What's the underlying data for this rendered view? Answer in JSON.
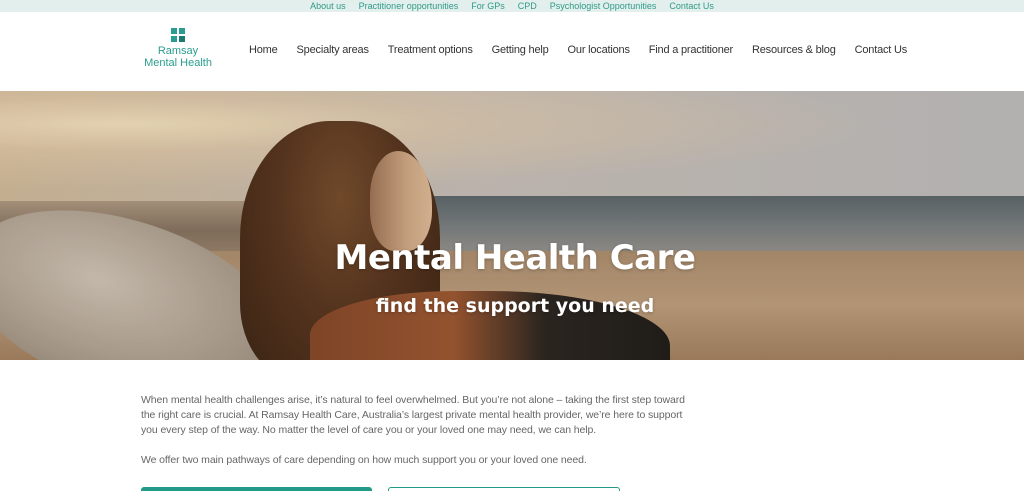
{
  "utility_nav": {
    "items": [
      "About us",
      "Practitioner opportunities",
      "For GPs",
      "CPD",
      "Psychologist Opportunities",
      "Contact Us"
    ]
  },
  "logo": {
    "line1": "Ramsay",
    "line2": "Mental Health",
    "icon": "ramsay-cross-logo"
  },
  "main_nav": {
    "items": [
      "Home",
      "Specialty areas",
      "Treatment options",
      "Getting help",
      "Our locations",
      "Find a practitioner",
      "Resources & blog",
      "Contact Us"
    ]
  },
  "hero": {
    "title": "Mental Health Care",
    "subtitle": "find the support you need"
  },
  "intro": {
    "paragraph1": "When mental health challenges arise, it’s natural to feel overwhelmed. But you’re not alone – taking the first step toward the right care is crucial. At Ramsay Health Care, Australia’s largest private mental health provider, we’re here to support you every step of the way. No matter the level of care you or your loved one may need, we can help.",
    "paragraph2": "We offer two main pathways of care depending on how much support you or your loved one need."
  },
  "colors": {
    "brand_teal": "#2a9d8f",
    "topbar_bg": "#e3efec"
  }
}
